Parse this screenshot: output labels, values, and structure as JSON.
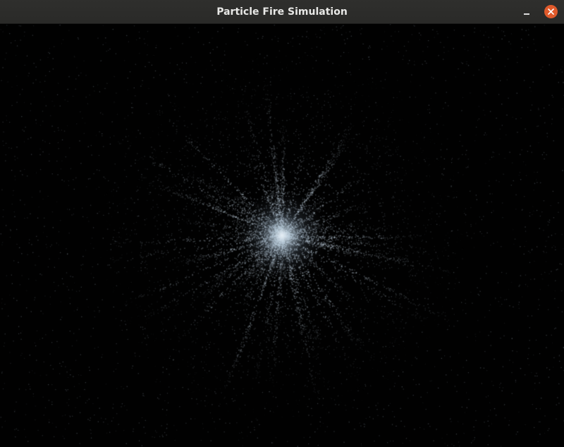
{
  "window": {
    "title": "Particle Fire Simulation"
  },
  "controls": {
    "minimize_icon": "minimize-icon",
    "close_icon": "close-icon"
  },
  "colors": {
    "titlebar": "#2c2c2a",
    "title_text": "#e8e8e6",
    "close_button": "#e05a2b",
    "background": "#000000",
    "particle": "#c8d2dc",
    "core": "#e8f0f6"
  }
}
